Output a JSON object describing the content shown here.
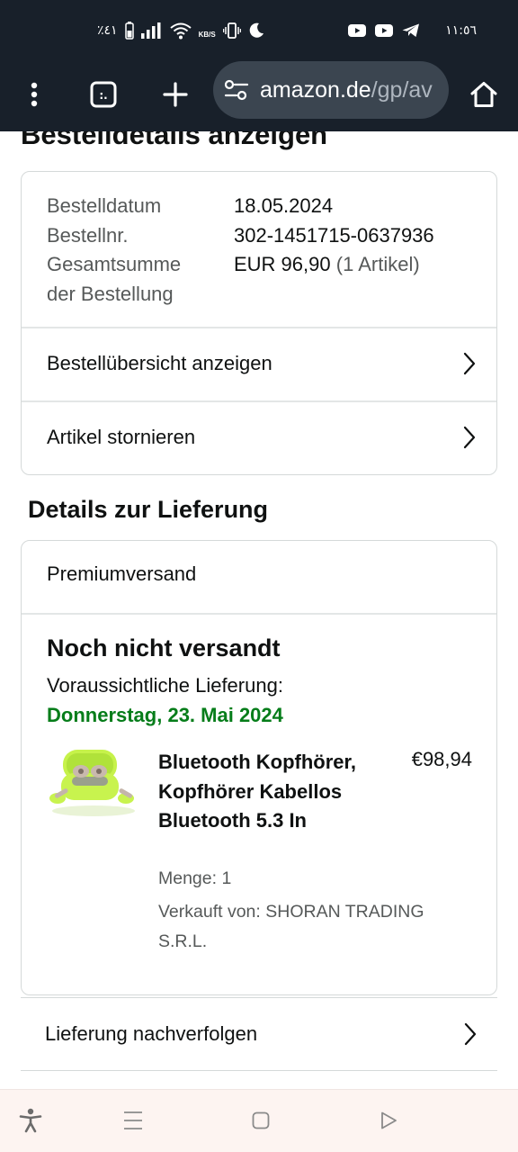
{
  "status_bar": {
    "battery_percent": "٪٤١",
    "net_speed_unit": "KB/S",
    "time": "١١:٥٦"
  },
  "browser": {
    "url": "amazon.de",
    "url_path": "/gp/av"
  },
  "page": {
    "title": "Bestelldetails anzeigen"
  },
  "order": {
    "date_label": "Bestelldatum",
    "date_value": "18.05.2024",
    "number_label": "Bestellnr.",
    "number_value": "302-1451715-0637936",
    "total_label_line1": "Gesamtsumme",
    "total_label_line2": "der Bestellung",
    "total_value": "EUR 96,90",
    "total_items": "(1 Artikel)",
    "summary_link": "Bestellübersicht anzeigen",
    "cancel_link": "Artikel stornieren"
  },
  "delivery": {
    "section_title": "Details zur Lieferung",
    "shipping_method": "Premiumversand",
    "status": "Noch nicht versandt",
    "expected_label": "Voraussichtliche Lieferung:",
    "expected_date": "Donnerstag, 23. Mai 2024",
    "track_link": "Lieferung nachverfolgen"
  },
  "product": {
    "title": "Bluetooth Kopfhörer, Kopfhörer Kabellos Bluetooth 5.3 In",
    "price": "€98,94",
    "quantity": "Menge: 1",
    "seller": "Verkauft von: SHORAN TRADING S.R.L."
  },
  "colors": {
    "status_bar_bg": "#18202a",
    "delivery_green": "#067d1a",
    "card_border": "#d5d9d9",
    "nav_bar_bg": "#fdf4f1"
  }
}
